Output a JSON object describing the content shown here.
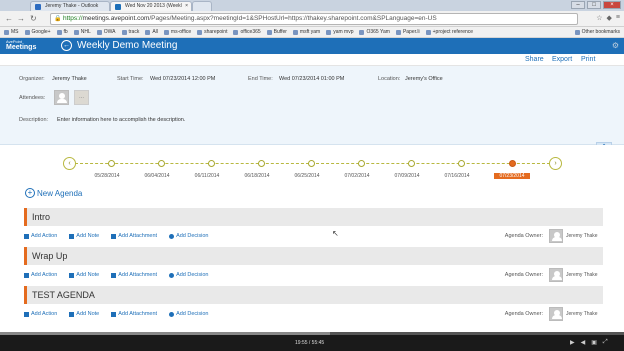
{
  "browser": {
    "tabs": [
      {
        "label": "Jeremy Thake - Outlook",
        "active": false
      },
      {
        "label": "Wed Nov 20 2013 (Weekl",
        "active": true
      },
      {
        "label": "",
        "active": false
      }
    ],
    "url_scheme": "https://",
    "url_host": "meetings.avepoint.com",
    "url_rest": "/Pages/Meeting.aspx?meetingId=1&SPHostUrl=https://thakey.sharepoint.com&SPLanguage=en-US",
    "bookmarks": [
      "MS",
      "Google+",
      "fb",
      "NHL",
      "OWA",
      "track",
      "All",
      "ms-office",
      "sharepoint",
      "office365",
      "Buffer",
      "msft yam",
      "yam mvp",
      "O365 Yam",
      "Paper.li",
      "+project reference"
    ],
    "other_bookmarks": "Other bookmarks"
  },
  "app": {
    "logo_small": "AvePoint",
    "logo_big": "Meetings",
    "meeting_title": "Weekly Demo Meeting"
  },
  "actions": {
    "share": "Share",
    "export": "Export",
    "print": "Print"
  },
  "details": {
    "organizer_label": "Organizer:",
    "organizer": "Jeremy Thake",
    "start_label": "Start Time:",
    "start": "Wed 07/23/2014 12:00 PM",
    "end_label": "End Time:",
    "end": "Wed 07/23/2014 01:00 PM",
    "location_label": "Location:",
    "location": "Jeremy's Office",
    "attendees_label": "Attendees:",
    "add_attendee": "...",
    "description_label": "Description:",
    "description": "Enter information here to accomplish the description."
  },
  "timeline": {
    "dates": [
      "05/28/2014",
      "06/04/2014",
      "06/11/2014",
      "06/18/2014",
      "06/25/2014",
      "07/02/2014",
      "07/09/2014",
      "07/16/2014",
      "07/23/2014"
    ],
    "active_index": 8
  },
  "new_agenda": "New Agenda",
  "agenda_actions": {
    "add_action": "Add Action",
    "add_note": "Add Note",
    "add_attachment": "Add Attachment",
    "add_decision": "Add Decision",
    "owner_label": "Agenda Owner:",
    "owner_name": "Jeremy Thake"
  },
  "agendas": [
    {
      "title": "Intro"
    },
    {
      "title": "Wrap Up"
    },
    {
      "title": "TEST AGENDA"
    }
  ],
  "player": {
    "time": "19:55 / 55:45",
    "progress": 0.35
  }
}
